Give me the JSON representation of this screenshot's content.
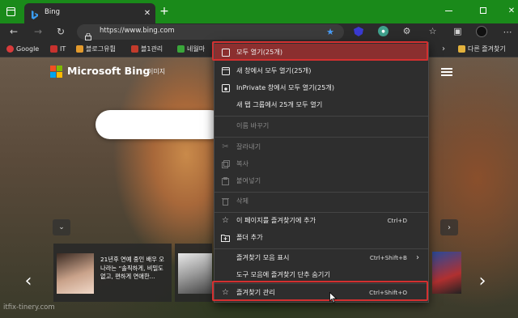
{
  "tab": {
    "title": "Bing"
  },
  "address": {
    "url": "https://www.bing.com"
  },
  "favorites": [
    {
      "label": "Google",
      "color": "#d93b3b"
    },
    {
      "label": "IT",
      "color": "#c8322e"
    },
    {
      "label": "블로그유튑",
      "color": "#e39a2c"
    },
    {
      "label": "블1관리",
      "color": "#c33b2b"
    },
    {
      "label": "네월마",
      "color": "#3aa63a"
    }
  ],
  "favorites_folder": "다른 즐겨찾기",
  "bing": {
    "brand": "Microsoft Bing",
    "nav_images": "이미지"
  },
  "news": {
    "text": "21년후 연예 중인 배우 오나라는 “솔직하게, 비밀도 없고, 편하게 연애한..."
  },
  "watermark": "itfix-tinery.com",
  "menu": {
    "open_all": "모두 열기(25개)",
    "open_all_new_window": "새 창에서 모두 열기(25개)",
    "open_all_inprivate": "InPrivate 창에서 모두 열기(25개)",
    "open_all_new_tab_group": "새 탭 그룹에서 25개 모두 열기",
    "rename": "이름 바꾸기",
    "cut": "잘라내기",
    "copy": "복사",
    "paste": "붙여넣기",
    "delete": "삭제",
    "add_page": "이 페이지를 즐겨찾기에 추가",
    "add_page_shortcut": "Ctrl+D",
    "add_folder": "폴더 추가",
    "show_favorites_bar": "즐겨찾기 모음 표시",
    "show_favorites_bar_shortcut": "Ctrl+Shift+B",
    "hide_favorites_button": "도구 모음에 즐겨찾기 단추 숨기기",
    "manage_favorites": "즐겨찾기 관리",
    "manage_favorites_shortcut": "Ctrl+Shift+O"
  },
  "colors": {
    "tabstrip": "#1a8a1a",
    "highlight": "#d43030",
    "menu_bg": "#2e2e2e"
  }
}
